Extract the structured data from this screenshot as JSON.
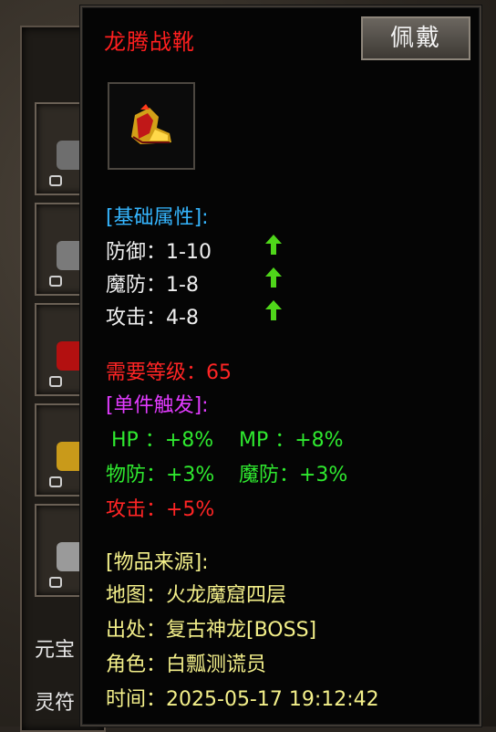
{
  "background_side": {
    "currency_label_1": "元宝",
    "currency_label_2": "灵符"
  },
  "tooltip": {
    "item_name": "龙腾战靴",
    "equip_button": "佩戴",
    "base_section_title": "[基础属性]:",
    "base_stats": [
      {
        "label": "防御：",
        "value": "1-10"
      },
      {
        "label": "魔防：",
        "value": "1-8"
      },
      {
        "label": "攻击：",
        "value": "4-8"
      }
    ],
    "required_level_label": "需要等级：",
    "required_level_value": "65",
    "set_trigger_title": "[单件触发]:",
    "set_bonus": {
      "hp": "HP ：+8%",
      "mp": "MP ：+8%",
      "phys_def": "物防：+3%",
      "mag_def": "魔防：+3%",
      "attack": "攻击：+5%"
    },
    "source_title": "[物品来源]:",
    "source": [
      {
        "label": "地图：",
        "value": "火龙魔窟四层"
      },
      {
        "label": "出处：",
        "value": "复古神龙[BOSS]"
      },
      {
        "label": "角色：",
        "value": "白瓢测谎员"
      },
      {
        "label": "时间：",
        "value": "2025-05-17 19:12:42"
      }
    ]
  },
  "colors": {
    "item_name": "#ff1f1f",
    "section_blue": "#35b6ff",
    "set_magenta": "#e23bff",
    "bonus_green": "#2fea2f",
    "source_yellow": "#f4f08a"
  }
}
